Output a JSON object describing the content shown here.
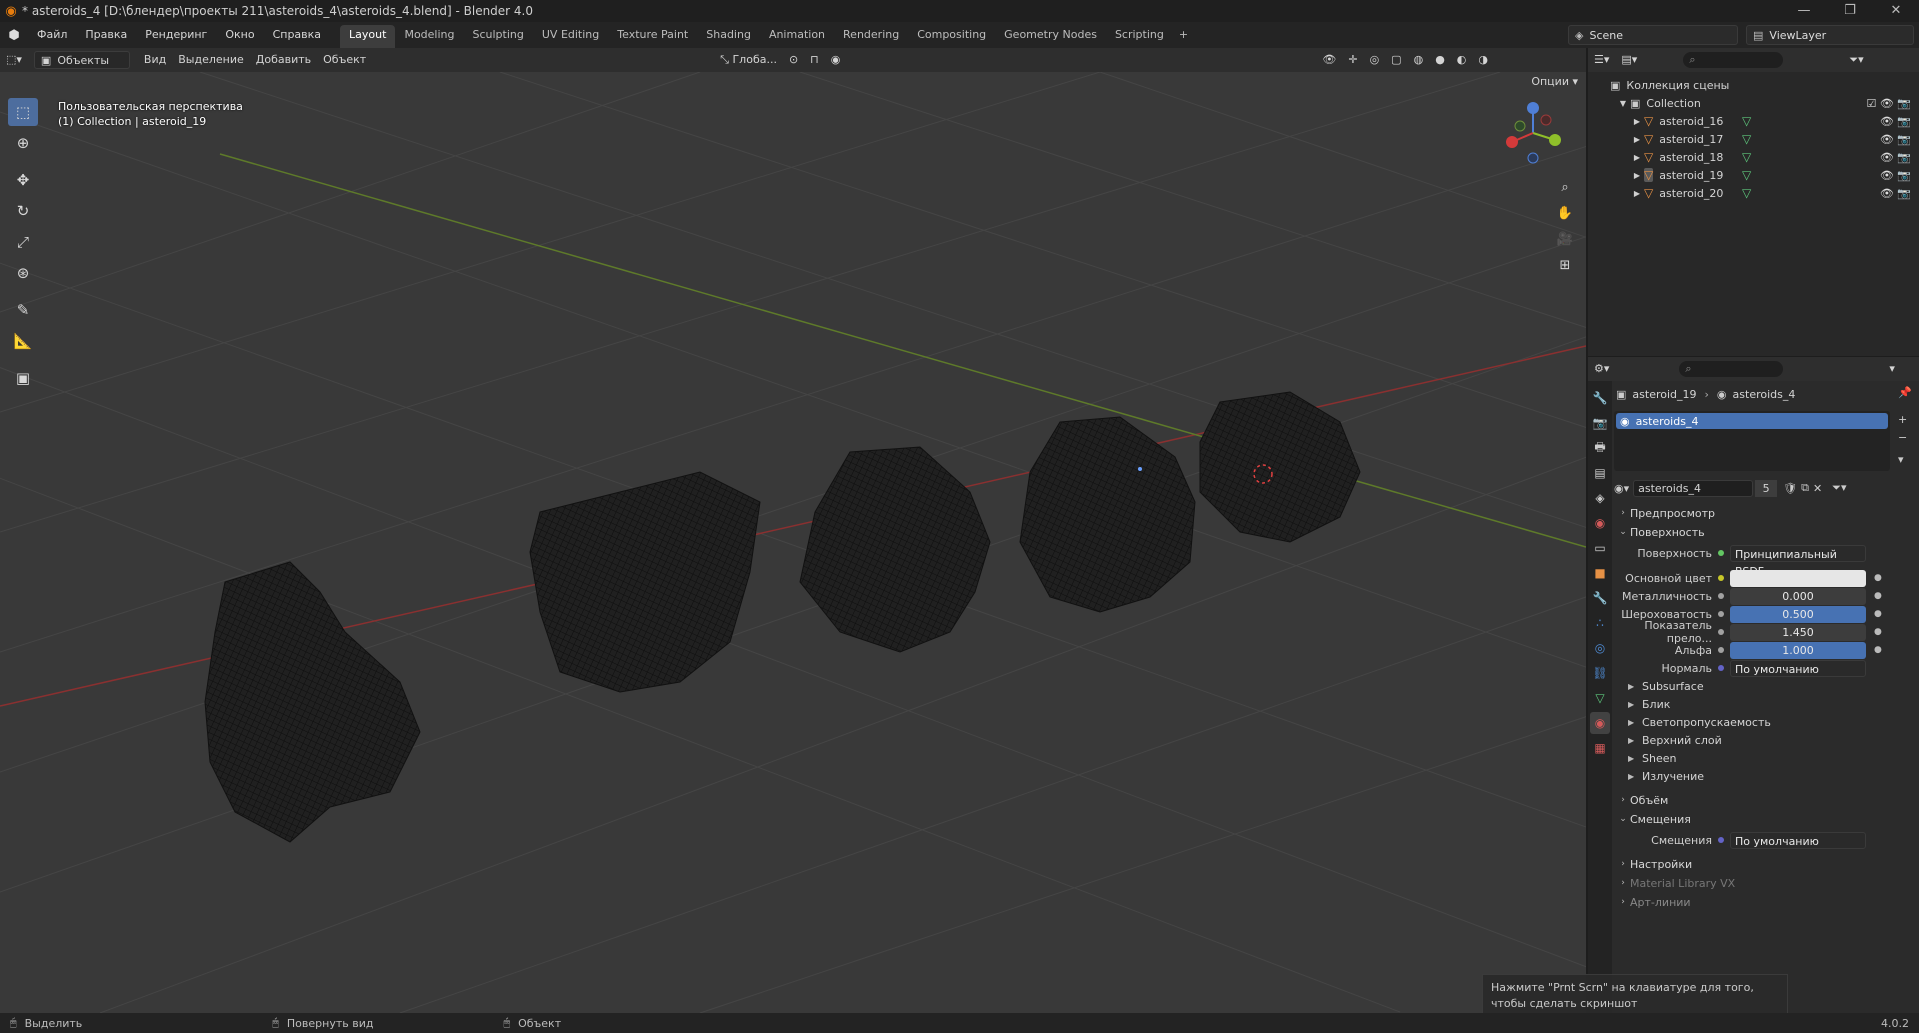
{
  "window": {
    "title": "* asteroids_4 [D:\\блендер\\проекты 211\\asteroids_4\\asteroids_4.blend] - Blender 4.0",
    "controls": [
      "—",
      "❐",
      "✕"
    ]
  },
  "menu": [
    "Файл",
    "Правка",
    "Рендеринг",
    "Окно",
    "Справка"
  ],
  "workspaces": {
    "tabs": [
      "Layout",
      "Modeling",
      "Sculpting",
      "UV Editing",
      "Texture Paint",
      "Shading",
      "Animation",
      "Rendering",
      "Compositing",
      "Geometry Nodes",
      "Scripting"
    ],
    "active": "Layout",
    "add": "+"
  },
  "scene": {
    "name": "Scene",
    "view_layer": "ViewLayer"
  },
  "viewport": {
    "mode": "Объекты",
    "menus": [
      "Вид",
      "Выделение",
      "Добавить",
      "Объект"
    ],
    "transform_orientation": "Глоба...",
    "options_label": "Опции",
    "view_name": "Пользовательская перспектива",
    "view_collection": "(1) Collection | asteroid_19",
    "tools": [
      "select-box",
      "cursor",
      "move",
      "rotate",
      "scale",
      "transform",
      "annotate",
      "measure",
      "add-cube"
    ]
  },
  "outliner": {
    "root": "Коллекция сцены",
    "collection": "Collection",
    "objects": [
      "asteroid_16",
      "asteroid_17",
      "asteroid_18",
      "asteroid_19",
      "asteroid_20"
    ],
    "active_object": "asteroid_19"
  },
  "properties": {
    "breadcrumb": {
      "object": "asteroid_19",
      "material": "asteroids_4"
    },
    "material_slot": "asteroids_4",
    "material_name": "asteroids_4",
    "users": "5",
    "panels": {
      "preview": "Предпросмотр",
      "surface": "Поверхность",
      "volume": "Объём",
      "displacement": "Смещения",
      "settings": "Настройки",
      "material_library": "Material Library VX",
      "line_art": "Арт-линии"
    },
    "surface_fields": [
      {
        "label": "Поверхность",
        "value": "Принципиальный BSDF"
      },
      {
        "label": "Основной цвет",
        "value": ""
      },
      {
        "label": "Металличность",
        "value": "0.000"
      },
      {
        "label": "Шероховатость",
        "value": "0.500"
      },
      {
        "label": "Показатель прело...",
        "value": "1.450"
      },
      {
        "label": "Альфа",
        "value": "1.000"
      },
      {
        "label": "Нормаль",
        "value": "По умолчанию"
      }
    ],
    "subpanels": [
      "Subsurface",
      "Блик",
      "Светопропускаемость",
      "Верхний слой",
      "Sheen",
      "Излучение"
    ],
    "displacement_field": {
      "label": "Смещения",
      "value": "По умолчанию"
    },
    "colors": {
      "base_color": "#e6e6e6",
      "accent": "#4772b3"
    }
  },
  "tooltip": "Нажмите \"Prnt Scrn\" на клавиатуре для того, чтобы сделать скриншот",
  "status": {
    "select": "Выделить",
    "rotate": "Повернуть вид",
    "object": "Объект",
    "version": "4.0.2"
  }
}
